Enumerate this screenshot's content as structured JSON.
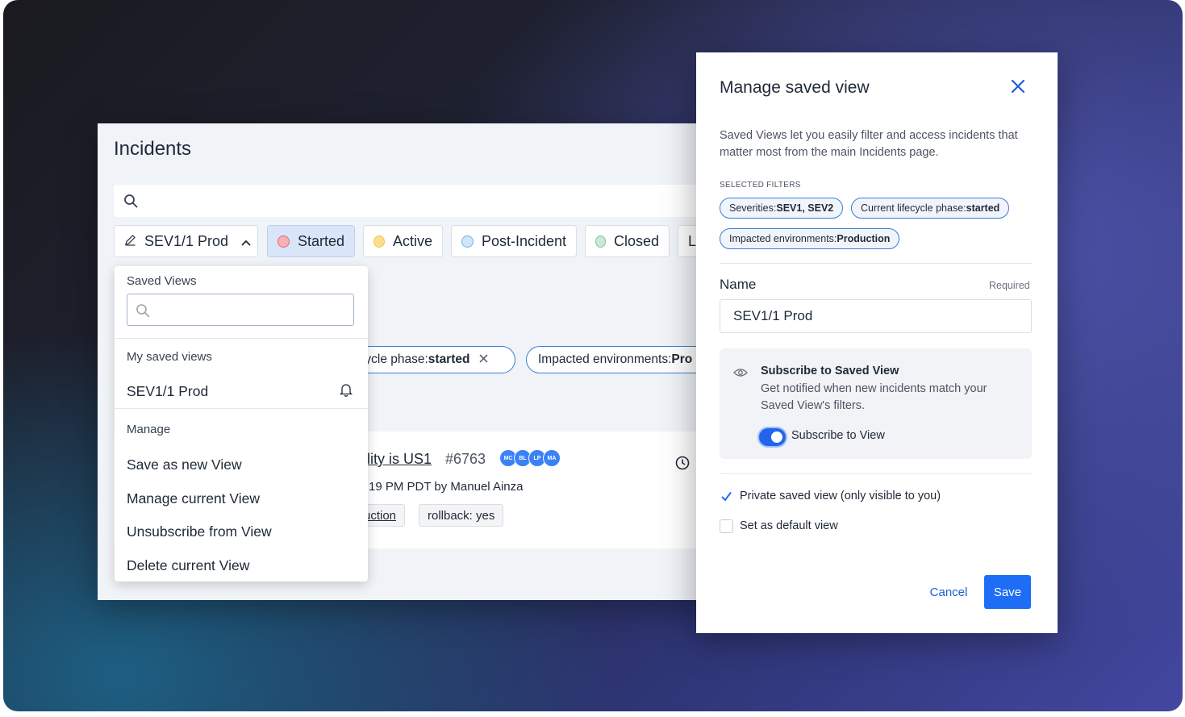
{
  "incidents": {
    "title": "Incidents",
    "search_placeholder": "",
    "filters": [
      {
        "label": "SEV1/1 Prod",
        "icon": "pencil-icon"
      },
      {
        "label": "Started",
        "dot_color": "#f7b0b6",
        "dot_border": "#e46470"
      },
      {
        "label": "Active",
        "dot_color": "#fbe08c",
        "dot_border": "#f0c64a"
      },
      {
        "label": "Post-Incident",
        "dot_color": "#cfe6fa",
        "dot_border": "#6fb0ea"
      },
      {
        "label": "Closed",
        "dot_color": "#cde9d6",
        "dot_border": "#7fc296"
      },
      {
        "label": "L"
      }
    ],
    "applied_filters": [
      {
        "prefix": "ecycle phase: ",
        "value": "started"
      },
      {
        "prefix": "Impacted environments: ",
        "value": "Pro"
      }
    ],
    "incident": {
      "title_fragment": "ility is US1",
      "number": "#6763",
      "avatars": [
        "MC",
        "BL",
        "LP",
        "MA"
      ],
      "meta": "19 PM PDT by Manuel Ainza",
      "labels": [
        "uction",
        "rollback: yes"
      ]
    }
  },
  "dropdown": {
    "header": "Saved Views",
    "search_placeholder": "",
    "my_section": "My saved views",
    "views": [
      "SEV1/1 Prod"
    ],
    "manage_section": "Manage",
    "actions": [
      "Save as new View",
      "Manage current View",
      "Unsubscribe from View",
      "Delete current View"
    ]
  },
  "modal": {
    "title": "Manage saved view",
    "description": "Saved Views let you easily filter and access incidents that matter most from the main Incidents page.",
    "selected_filters_label": "SELECTED FILTERS",
    "selected_filters": [
      {
        "prefix": "Severities: ",
        "value": "SEV1, SEV2"
      },
      {
        "prefix": "Current lifecycle phase: ",
        "value": "started"
      },
      {
        "prefix": "Impacted environments: ",
        "value": "Production"
      }
    ],
    "name_label": "Name",
    "required_label": "Required",
    "name_value": "SEV1/1 Prod",
    "subscribe": {
      "title": "Subscribe to Saved View",
      "description": "Get notified when new incidents match your Saved View's filters.",
      "toggle_label": "Subscribe to View",
      "toggle_on": true
    },
    "private_label": "Private saved view (only visible to you)",
    "private_checked": true,
    "default_label": "Set as default view",
    "default_checked": false,
    "cancel_label": "Cancel",
    "save_label": "Save"
  },
  "colors": {
    "accent": "#1d6ef5",
    "link": "#1d5fd6",
    "pill_border": "#3a7bd5"
  }
}
